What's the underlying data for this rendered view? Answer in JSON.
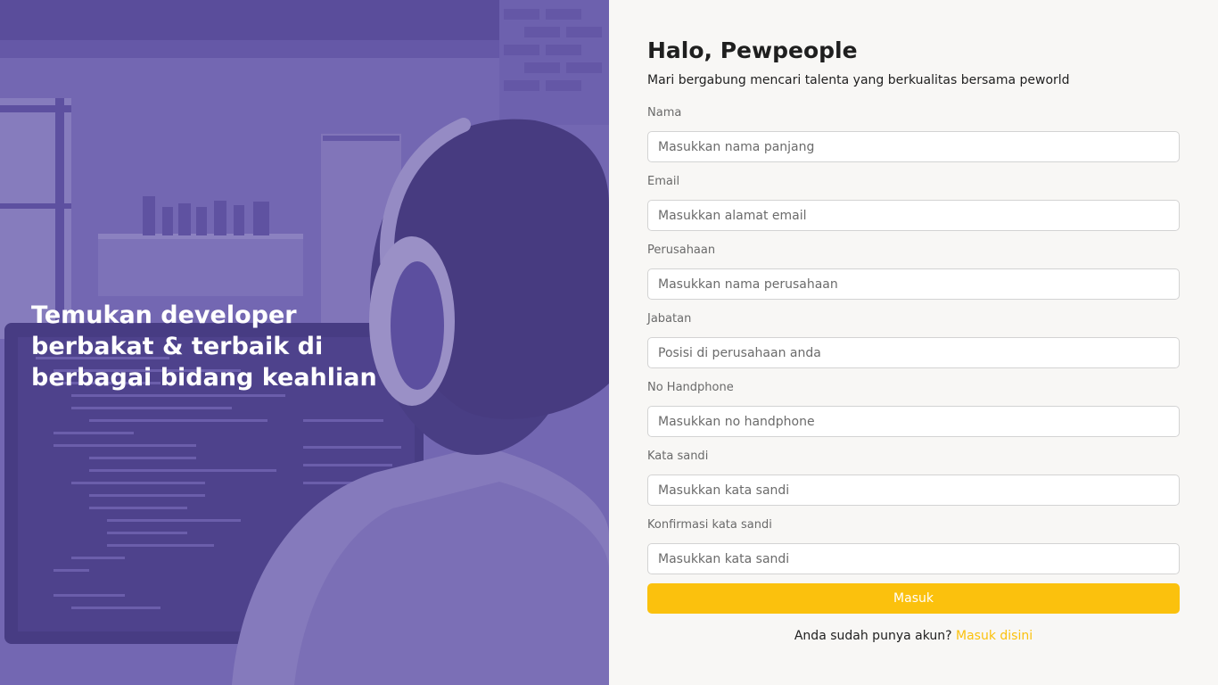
{
  "hero": {
    "tagline": "Temukan developer berbakat & terbaik di berbagai bidang keahlian"
  },
  "form": {
    "greeting": "Halo, Pewpeople",
    "subtitle": "Mari bergabung mencari talenta yang berkualitas bersama peworld",
    "fields": [
      {
        "label": "Nama",
        "placeholder": "Masukkan nama panjang",
        "value": ""
      },
      {
        "label": "Email",
        "placeholder": "Masukkan alamat email",
        "value": ""
      },
      {
        "label": "Perusahaan",
        "placeholder": "Masukkan nama perusahaan",
        "value": ""
      },
      {
        "label": "Jabatan",
        "placeholder": "Posisi di perusahaan anda",
        "value": ""
      },
      {
        "label": "No Handphone",
        "placeholder": "Masukkan no handphone",
        "value": ""
      },
      {
        "label": "Kata sandi",
        "placeholder": "Masukkan kata sandi",
        "value": ""
      },
      {
        "label": "Konfirmasi kata sandi",
        "placeholder": "Masukkan kata sandi",
        "value": ""
      }
    ],
    "submit_label": "Masuk",
    "signin_prompt": "Anda sudah punya akun?",
    "signin_link": "Masuk disini"
  },
  "colors": {
    "accent": "#fbc10d",
    "hero_overlay": "#5e50a1",
    "panel_background": "#f8f7f5"
  }
}
